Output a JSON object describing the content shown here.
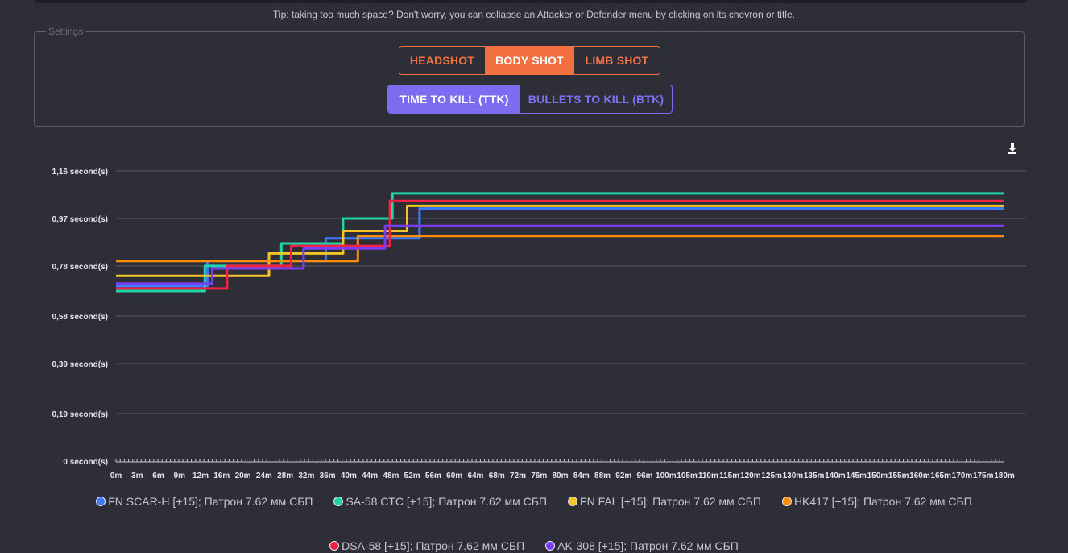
{
  "tip": "Tip: taking too much space? Don't worry, you can collapse an Attacker or Defender menu by clicking on its chevron or title.",
  "settings": {
    "legend": "Settings",
    "shot_buttons": [
      {
        "label": "HEADSHOT",
        "active": false
      },
      {
        "label": "BODY SHOT",
        "active": true
      },
      {
        "label": "LIMB SHOT",
        "active": false
      }
    ],
    "mode_buttons": [
      {
        "label": "TIME TO KILL (TTK)",
        "active": true
      },
      {
        "label": "BULLETS TO KILL (BTK)",
        "active": false
      }
    ]
  },
  "download_icon": "download-icon",
  "chart_data": {
    "type": "line",
    "step": true,
    "ylim": [
      0,
      1.16
    ],
    "yticks": [
      0,
      0.19,
      0.39,
      0.58,
      0.78,
      0.97,
      1.16
    ],
    "ytick_labels": [
      "0 second(s)",
      "0,19 second(s)",
      "0,39 second(s)",
      "0,58 second(s)",
      "0,78 second(s)",
      "0,97 second(s)",
      "1,16 second(s)"
    ],
    "xlim": [
      0,
      180
    ],
    "xtick_labels": [
      "0m",
      "3m",
      "6m",
      "9m",
      "12m",
      "16m",
      "20m",
      "24m",
      "28m",
      "32m",
      "36m",
      "40m",
      "44m",
      "48m",
      "52m",
      "56m",
      "60m",
      "64m",
      "68m",
      "72m",
      "76m",
      "80m",
      "84m",
      "88m",
      "92m",
      "96m",
      "100m",
      "105m",
      "110m",
      "115m",
      "120m",
      "125m",
      "130m",
      "135m",
      "140m",
      "145m",
      "150m",
      "155m",
      "160m",
      "165m",
      "170m",
      "175m",
      "180m"
    ],
    "grid": true,
    "legend_position": "bottom",
    "series": [
      {
        "name": "FN SCAR-H [+15]; Патрон 7.62 мм СБП",
        "color": "#3a7bff",
        "points": [
          [
            0,
            0.7
          ],
          [
            18.5,
            0.7
          ],
          [
            18.5,
            0.8
          ],
          [
            42.5,
            0.8
          ],
          [
            42.5,
            0.89
          ],
          [
            61.5,
            0.89
          ],
          [
            61.5,
            1.01
          ],
          [
            180,
            1.01
          ]
        ]
      },
      {
        "name": "SA-58 CTC [+15]; Патрон 7.62 мм СБП",
        "color": "#21d5a7",
        "points": [
          [
            0,
            0.68
          ],
          [
            18,
            0.68
          ],
          [
            18,
            0.78
          ],
          [
            33.5,
            0.78
          ],
          [
            33.5,
            0.87
          ],
          [
            46,
            0.87
          ],
          [
            46,
            0.97
          ],
          [
            56,
            0.97
          ],
          [
            56,
            1.07
          ],
          [
            180,
            1.07
          ]
        ]
      },
      {
        "name": "FN FAL [+15]; Патрон 7.62 мм СБП",
        "color": "#f4c524",
        "points": [
          [
            0,
            0.74
          ],
          [
            31,
            0.74
          ],
          [
            31,
            0.83
          ],
          [
            46,
            0.83
          ],
          [
            46,
            0.92
          ],
          [
            59,
            0.92
          ],
          [
            59,
            1.02
          ],
          [
            180,
            1.02
          ]
        ]
      },
      {
        "name": "HK417 [+15]; Патрон 7.62 мм СБП",
        "color": "#ff8c0a",
        "points": [
          [
            0,
            0.8
          ],
          [
            49,
            0.8
          ],
          [
            49,
            0.9
          ],
          [
            180,
            0.9
          ]
        ]
      },
      {
        "name": "DSA-58 [+15]; Патрон 7.62 мм СБП",
        "color": "#ee2244",
        "points": [
          [
            0,
            0.69
          ],
          [
            22.5,
            0.69
          ],
          [
            22.5,
            0.78
          ],
          [
            35.5,
            0.78
          ],
          [
            35.5,
            0.86
          ],
          [
            55.5,
            0.86
          ],
          [
            55.5,
            1.04
          ],
          [
            180,
            1.04
          ]
        ]
      },
      {
        "name": "AK-308 [+15]; Патрон 7.62 мм СБП",
        "color": "#7b3cf5",
        "points": [
          [
            0,
            0.71
          ],
          [
            19.5,
            0.71
          ],
          [
            19.5,
            0.77
          ],
          [
            38,
            0.77
          ],
          [
            38,
            0.85
          ],
          [
            54.5,
            0.85
          ],
          [
            54.5,
            0.94
          ],
          [
            180,
            0.94
          ]
        ]
      }
    ]
  }
}
